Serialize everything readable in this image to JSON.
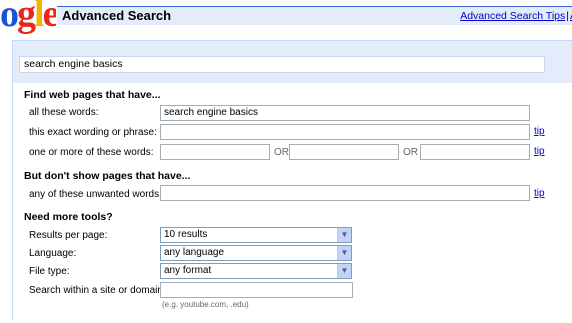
{
  "logo": {
    "text": "ogle"
  },
  "header": {
    "title": "Advanced Search",
    "links": [
      "Advanced Search Tips",
      "A"
    ]
  },
  "search_box": {
    "value": "search engine basics"
  },
  "find": {
    "heading": "Find web pages that have...",
    "all_words_label": "all these words:",
    "all_words_value": "search engine basics",
    "exact_label": "this exact wording or phrase:",
    "one_or_more_label": "one or more of these words:",
    "or_label": "OR",
    "tip": "tip"
  },
  "exclude": {
    "heading": "But don't show pages that have...",
    "unwanted_label": "any of these unwanted words:",
    "tip": "tip"
  },
  "tools": {
    "heading": "Need more tools?",
    "results_label": "Results per page:",
    "results_value": "10 results",
    "language_label": "Language:",
    "language_value": "any language",
    "filetype_label": "File type:",
    "filetype_value": "any format",
    "site_label": "Search within a site or domain:",
    "site_example": "(e.g. youtube.com, .edu)"
  }
}
